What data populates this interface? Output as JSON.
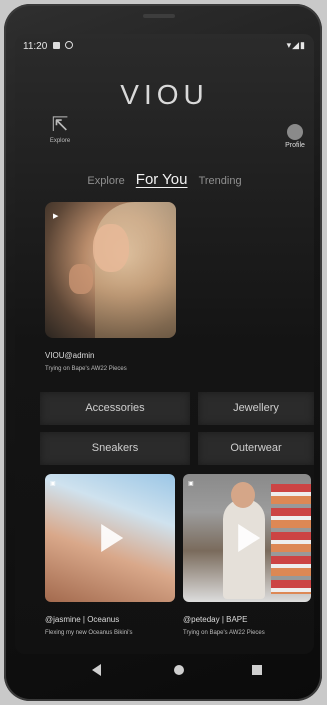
{
  "status_bar": {
    "time": "11:20",
    "icons": "▾◢▮"
  },
  "app": {
    "logo": "VIOU"
  },
  "header": {
    "explore_label": "Explore",
    "profile_label": "Profile"
  },
  "tabs": [
    {
      "label": "Explore",
      "active": false
    },
    {
      "label": "For You",
      "active": true
    },
    {
      "label": "Trending",
      "active": false
    }
  ],
  "featured": {
    "badge": "▶",
    "author": "VIOU@admin",
    "title": "Trying on Bape's AW22 Pieces"
  },
  "categories": [
    "Accessories",
    "Jewellery",
    "Sneakers",
    "Outerwear"
  ],
  "videos": [
    {
      "author": "@jasmine | Oceanus",
      "caption": "Flexing my new Oceanus Bikini's"
    },
    {
      "author": "@peteday | BAPE",
      "caption": "Trying on Bape's AW22 Pieces"
    }
  ]
}
